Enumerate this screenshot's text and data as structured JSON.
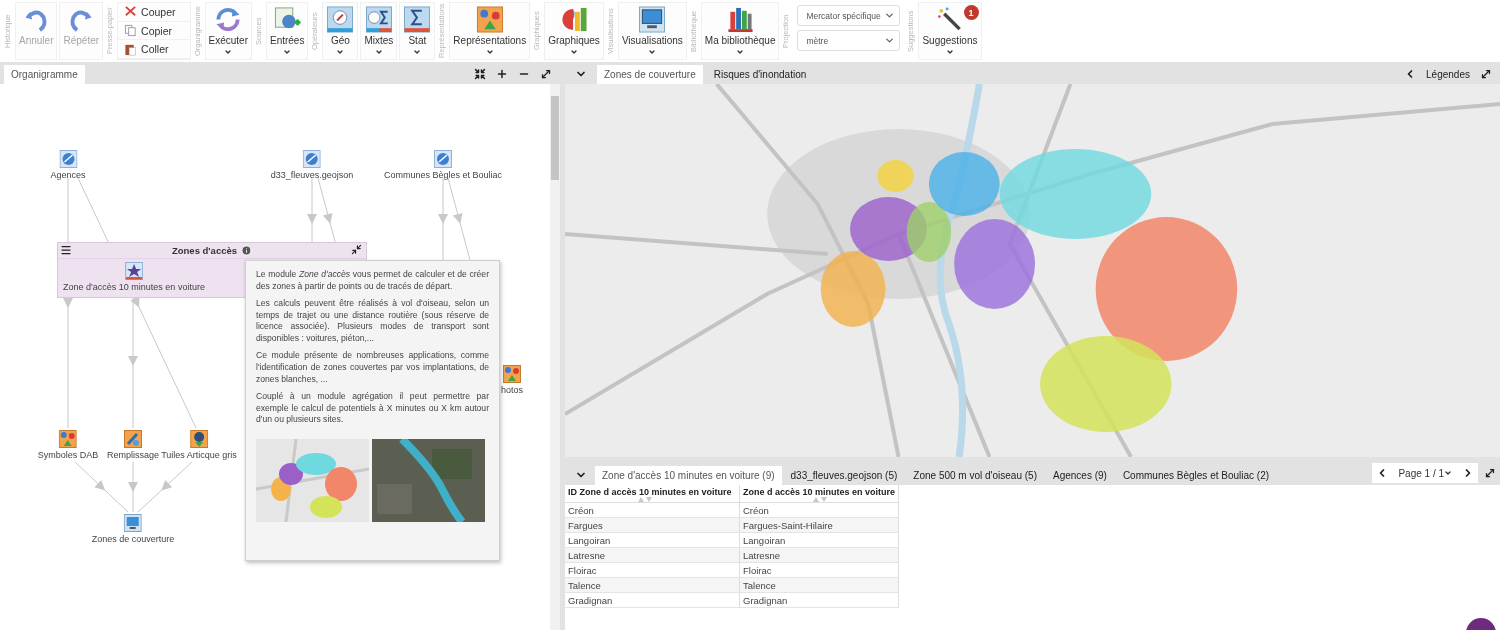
{
  "toolbar": {
    "groups": [
      {
        "label": "Historique",
        "kind": "large",
        "buttons": [
          {
            "label": "Annuler",
            "disabled": true,
            "dropdown": false
          },
          {
            "label": "Répéter",
            "disabled": true,
            "dropdown": false
          }
        ]
      },
      {
        "label": "Presse-papier",
        "kind": "small",
        "buttons": [
          {
            "label": "Couper",
            "disabled": false
          },
          {
            "label": "Copier",
            "disabled": false
          },
          {
            "label": "Coller",
            "disabled": false
          }
        ]
      },
      {
        "label": "Organigramme",
        "kind": "large",
        "buttons": [
          {
            "label": "Exécuter",
            "disabled": false,
            "dropdown": true
          }
        ]
      },
      {
        "label": "Sources",
        "kind": "large",
        "buttons": [
          {
            "label": "Entrées",
            "disabled": false,
            "dropdown": true
          }
        ]
      },
      {
        "label": "Opérateurs",
        "kind": "large",
        "buttons": [
          {
            "label": "Géo",
            "disabled": false,
            "dropdown": true
          },
          {
            "label": "Mixtes",
            "disabled": false,
            "dropdown": true
          },
          {
            "label": "Stat",
            "disabled": false,
            "dropdown": true
          }
        ]
      },
      {
        "label": "Représentations",
        "kind": "large",
        "buttons": [
          {
            "label": "Représentations",
            "disabled": false,
            "dropdown": true
          }
        ]
      },
      {
        "label": "Graphiques",
        "kind": "large",
        "buttons": [
          {
            "label": "Graphiques",
            "disabled": false,
            "dropdown": true
          }
        ]
      },
      {
        "label": "Visualisations",
        "kind": "large",
        "buttons": [
          {
            "label": "Visualisations",
            "disabled": false,
            "dropdown": true
          }
        ]
      },
      {
        "label": "Bibliothèque",
        "kind": "large",
        "buttons": [
          {
            "label": "Ma bibliothèque",
            "disabled": false,
            "dropdown": true
          }
        ]
      },
      {
        "label": "Projection",
        "kind": "select",
        "selects": [
          {
            "value": "Mercator spécifique"
          },
          {
            "value": "mètre"
          }
        ]
      },
      {
        "label": "Suggestions",
        "kind": "large",
        "buttons": [
          {
            "label": "Suggestions",
            "disabled": false,
            "dropdown": true,
            "badge": "1"
          }
        ]
      }
    ]
  },
  "organigram": {
    "tab": "Organigramme",
    "nodes": [
      {
        "label": "Agences"
      },
      {
        "label": "d33_fleuves.geojson"
      },
      {
        "label": "Communes Bègles et Bouliac"
      },
      {
        "label": "Symboles DAB"
      },
      {
        "label": "Remplissage"
      },
      {
        "label": "Tuiles Articque gris"
      },
      {
        "label": "Zones de couverture"
      },
      {
        "label": "hotos"
      }
    ],
    "group": {
      "title": "Zones d'accès",
      "nodes": [
        {
          "label": "Zone d'accès 10 minutes en voiture"
        }
      ]
    },
    "tooltip": {
      "paragraphs": [
        "Le module *Zone d'accès* vous permet de calculer et de créer des zones à partir de points ou de tracés de départ.",
        "Les calculs peuvent être réalisés à vol d'oiseau, selon un temps de trajet ou une distance routière (sous réserve de licence associée). Plusieurs modes de transport sont disponibles : voitures, piéton,...",
        "Ce module présente de nombreuses applications, comme l'identification de zones couvertes par vos implantations, de zones blanches, ...",
        "Couplé à un module agrégation il peut permettre par exemple le calcul de potentiels à X minutes ou X km autour d'un ou plusieurs sites."
      ],
      "pictures": [
        {
          "kind": "picture"
        },
        {
          "kind": "picture"
        }
      ]
    }
  },
  "map_panel": {
    "tabs": [
      {
        "label": "Zones de couverture",
        "selected": true
      },
      {
        "label": "Risques d'inondation",
        "selected": false
      }
    ],
    "legend_label": "Légendes",
    "map": {
      "kind": "picture"
    }
  },
  "data_panel": {
    "tabs": [
      {
        "label": "Zone d'accès 10 minutes en voiture (9)",
        "selected": true
      },
      {
        "label": "d33_fleuves.geojson (5)",
        "selected": false
      },
      {
        "label": "Zone 500 m vol d'oiseau (5)",
        "selected": false
      },
      {
        "label": "Agences (9)",
        "selected": false
      },
      {
        "label": "Communes Bègles et Bouliac (2)",
        "selected": false
      }
    ],
    "pager": "Page 1 / 1",
    "table": {
      "columns": [
        "ID Zone d accès 10 minutes en voiture",
        "Zone d accès 10 minutes en voiture"
      ],
      "rows": [
        [
          "Créon",
          "Créon"
        ],
        [
          "Fargues",
          "Fargues-Saint-Hilaire"
        ],
        [
          "Langoiran",
          "Langoiran"
        ],
        [
          "Latresne",
          "Latresne"
        ],
        [
          "Floirac",
          "Floirac"
        ],
        [
          "Talence",
          "Talence"
        ],
        [
          "Gradignan",
          "Gradignan"
        ]
      ]
    }
  }
}
